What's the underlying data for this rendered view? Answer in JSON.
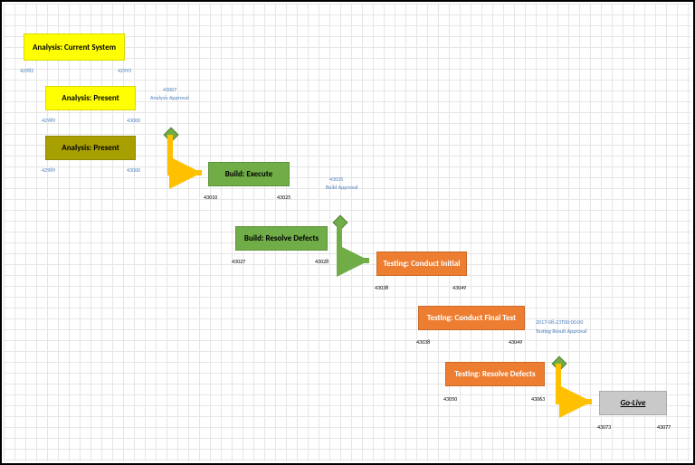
{
  "steps": {
    "s1": {
      "label": "Analysis: Current System",
      "start": "42982",
      "end": "42993"
    },
    "s2": {
      "label": "Analysis: Present",
      "start": "42989",
      "end": "43000"
    },
    "s3": {
      "label": "Analysis: Present",
      "start": "42989",
      "end": "43000"
    },
    "s4": {
      "label": "Build: Execute",
      "start": "43010",
      "end": "43025"
    },
    "s5": {
      "label": "Build: Resolve Defects",
      "start": "43027",
      "end": "43028"
    },
    "s6": {
      "label": "Testing: Conduct Initial",
      "start": "43038",
      "end": "43049"
    },
    "s7": {
      "label": "Testing: Conduct Final Test",
      "start": "43038",
      "end": "43049"
    },
    "s8": {
      "label": "Testing: Resolve Defects",
      "start": "43050",
      "end": "43063"
    },
    "s9": {
      "label": "Go-Live",
      "start": "43073",
      "end": "43077"
    }
  },
  "milestones": {
    "m1": {
      "date": "43007",
      "label": "Analysis Approval"
    },
    "m2": {
      "date": "43035",
      "label": "Build Approval"
    },
    "m3": {
      "date": "2017-08-23T00:00:00",
      "label": "Testing Result Approval"
    }
  }
}
